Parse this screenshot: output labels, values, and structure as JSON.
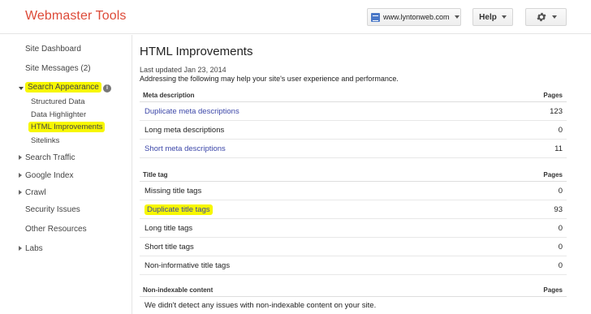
{
  "header": {
    "logo": "Webmaster Tools",
    "site": "www.lyntonweb.com",
    "help_label": "Help"
  },
  "sidebar": {
    "items": [
      {
        "label": "Site Dashboard"
      },
      {
        "label": "Site Messages (2)"
      },
      {
        "label": "Search Appearance"
      },
      {
        "label": "Structured Data"
      },
      {
        "label": "Data Highlighter"
      },
      {
        "label": "HTML Improvements"
      },
      {
        "label": "Sitelinks"
      },
      {
        "label": "Search Traffic"
      },
      {
        "label": "Google Index"
      },
      {
        "label": "Crawl"
      },
      {
        "label": "Security Issues"
      },
      {
        "label": "Other Resources"
      },
      {
        "label": "Labs"
      }
    ],
    "info_glyph": "i"
  },
  "main": {
    "title": "HTML Improvements",
    "updated": "Last updated Jan 23, 2014",
    "intro": "Addressing the following may help your site's user experience and performance.",
    "sections": [
      {
        "heading": "Meta description",
        "col": "Pages",
        "rows": [
          {
            "label": "Duplicate meta descriptions",
            "value": "123"
          },
          {
            "label": "Long meta descriptions",
            "value": "0"
          },
          {
            "label": "Short meta descriptions",
            "value": "11"
          }
        ]
      },
      {
        "heading": "Title tag",
        "col": "Pages",
        "rows": [
          {
            "label": "Missing title tags",
            "value": "0"
          },
          {
            "label": "Duplicate title tags",
            "value": "93"
          },
          {
            "label": "Long title tags",
            "value": "0"
          },
          {
            "label": "Short title tags",
            "value": "0"
          },
          {
            "label": "Non-informative title tags",
            "value": "0"
          }
        ]
      },
      {
        "heading": "Non-indexable content",
        "col": "Pages",
        "note": "We didn't detect any issues with non-indexable content on your site."
      }
    ]
  },
  "colors": {
    "logo": "#dd4b39",
    "link": "#3b46a8",
    "highlight": "#f7f700"
  }
}
